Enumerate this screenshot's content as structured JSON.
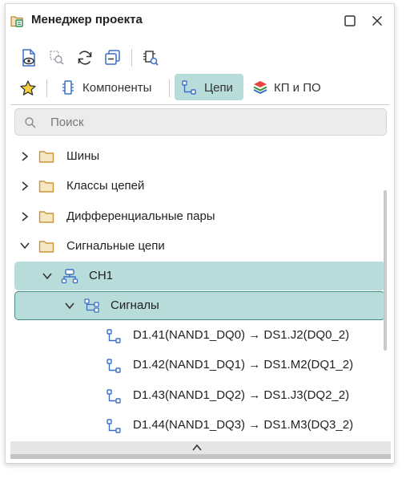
{
  "window": {
    "title": "Менеджер проекта",
    "maximize_icon": "maximize-icon",
    "close_icon": "close-icon"
  },
  "toolbar": {
    "buttons": [
      {
        "icon": "document-view-icon"
      },
      {
        "icon": "filter-find-icon"
      },
      {
        "icon": "refresh-icon"
      },
      {
        "icon": "collapse-all-icon"
      },
      {
        "icon": "chip-search-icon"
      }
    ]
  },
  "tabs": {
    "favorites_icon": "star-icon",
    "items": [
      {
        "label": "Компоненты",
        "icon": "component-icon",
        "active": false
      },
      {
        "label": "Цепи",
        "icon": "net-icon",
        "active": true
      },
      {
        "label": "КП и ПО",
        "icon": "layers-icon",
        "active": false
      }
    ]
  },
  "search": {
    "placeholder": "Поиск",
    "value": ""
  },
  "tree": {
    "rows": [
      {
        "label": "Шины",
        "expanded": false,
        "level": 0,
        "icon": "folder-icon"
      },
      {
        "label": "Классы цепей",
        "expanded": false,
        "level": 0,
        "icon": "folder-icon"
      },
      {
        "label": "Дифференциальные пары",
        "expanded": false,
        "level": 0,
        "icon": "folder-icon"
      },
      {
        "label": "Сигнальные цепи",
        "expanded": true,
        "level": 0,
        "icon": "folder-icon"
      },
      {
        "label": "CH1",
        "expanded": true,
        "level": 1,
        "icon": "channel-icon"
      },
      {
        "label": "Сигналы",
        "expanded": true,
        "level": 2,
        "icon": "signals-icon"
      },
      {
        "label": "D1.41(NAND1_DQ0) → DS1.J2(DQ0_2)",
        "level": 3,
        "icon": "net-icon"
      },
      {
        "label": "D1.42(NAND1_DQ1) → DS1.M2(DQ1_2)",
        "level": 3,
        "icon": "net-icon"
      },
      {
        "label": "D1.43(NAND1_DQ2) → DS1.J3(DQ2_2)",
        "level": 3,
        "icon": "net-icon"
      },
      {
        "label": "D1.44(NAND1_DQ3) → DS1.M3(DQ3_2)",
        "level": 3,
        "icon": "net-icon"
      }
    ]
  },
  "colors": {
    "accent": "#b7dcd9",
    "accent_border": "#3f8f8a",
    "icon_blue": "#3b6fc4",
    "folder": "#c9953a"
  }
}
